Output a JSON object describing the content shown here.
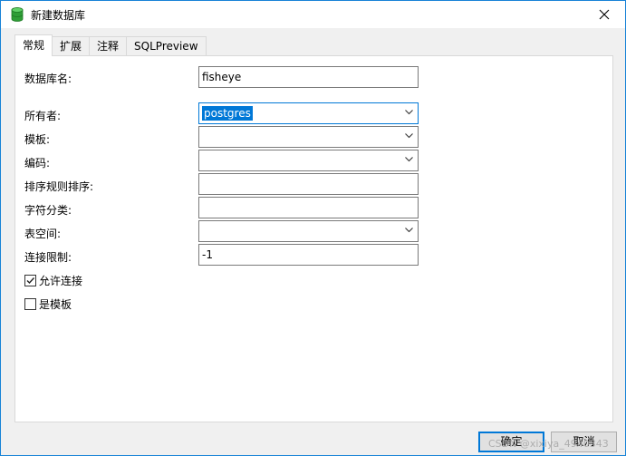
{
  "window": {
    "title": "新建数据库",
    "icon": "database-icon",
    "accent": "#1883d7"
  },
  "tabs": [
    {
      "label": "常规",
      "active": true
    },
    {
      "label": "扩展",
      "active": false
    },
    {
      "label": "注释",
      "active": false
    },
    {
      "label": "SQLPreview",
      "active": false
    }
  ],
  "form": {
    "db_name": {
      "label": "数据库名:",
      "value": "fisheye"
    },
    "owner": {
      "label": "所有者:",
      "value": "postgres"
    },
    "template": {
      "label": "模板:",
      "value": ""
    },
    "encoding": {
      "label": "编码:",
      "value": ""
    },
    "collation": {
      "label": "排序规则排序:",
      "value": ""
    },
    "ctype": {
      "label": "字符分类:",
      "value": ""
    },
    "tablespace": {
      "label": "表空间:",
      "value": ""
    },
    "conn_limit": {
      "label": "连接限制:",
      "value": "-1"
    },
    "allow_conn": {
      "label": "允许连接",
      "checked": true
    },
    "is_template": {
      "label": "是模板",
      "checked": false
    }
  },
  "buttons": {
    "ok": "确定",
    "cancel": "取消"
  },
  "watermark": "CSDN @xixiya_4940343"
}
